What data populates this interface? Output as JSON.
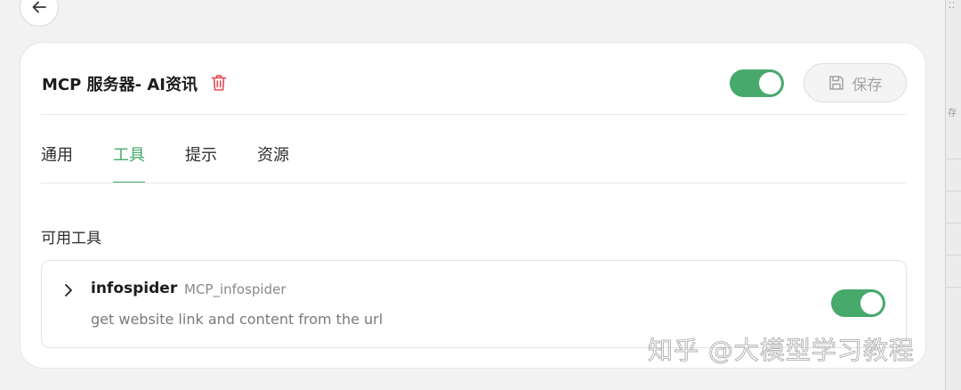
{
  "header": {
    "server_title": "MCP 服务器- AI资讯",
    "enabled": true,
    "save_label": "保存"
  },
  "tabs": [
    {
      "label": "通用",
      "active": false
    },
    {
      "label": "工具",
      "active": true
    },
    {
      "label": "提示",
      "active": false
    },
    {
      "label": "资源",
      "active": false
    }
  ],
  "tools_section": {
    "title": "可用工具",
    "items": [
      {
        "name": "infospider",
        "id": "MCP_infospider",
        "description": "get website link and content from the url",
        "enabled": true
      }
    ]
  },
  "watermark": "知乎 @大模型学习教程",
  "edge_fragment": "存",
  "colors": {
    "accent": "#47a96b",
    "danger": "#e5484d",
    "background": "#f2f2f2",
    "card": "#ffffff"
  },
  "icons": {
    "back": "arrow-left-icon",
    "delete": "trash-icon",
    "save": "floppy-disk-icon",
    "expand": "chevron-right-icon"
  }
}
